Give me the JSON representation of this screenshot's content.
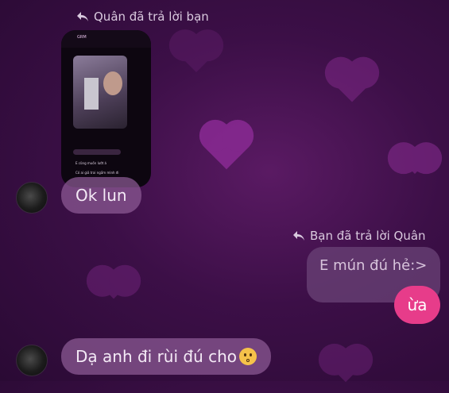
{
  "messages": {
    "reply_header_1": "Quân đã trả lời bạn",
    "thumbnail_title": "GRM",
    "thumbnail_line_1": "E cũng muốn lướt á",
    "thumbnail_line_2": "Có ai giả trai ngầm mình đi",
    "received_1": "Ok lun",
    "reply_header_2": "Bạn đã trả lời Quân",
    "quoted_text": "E mún đú hẻ:>",
    "sent_1": "ừa",
    "received_2": "Dạ anh đi rùi đú cho"
  },
  "colors": {
    "background": "#3c0f47",
    "received_bubble": "#8e5c96",
    "sent_bubble": "#e73c8a",
    "reply_text": "#d9c9de"
  },
  "icons": {
    "reply_arrow": "reply-arrow-icon",
    "emoji": "kissing-face-emoji"
  }
}
